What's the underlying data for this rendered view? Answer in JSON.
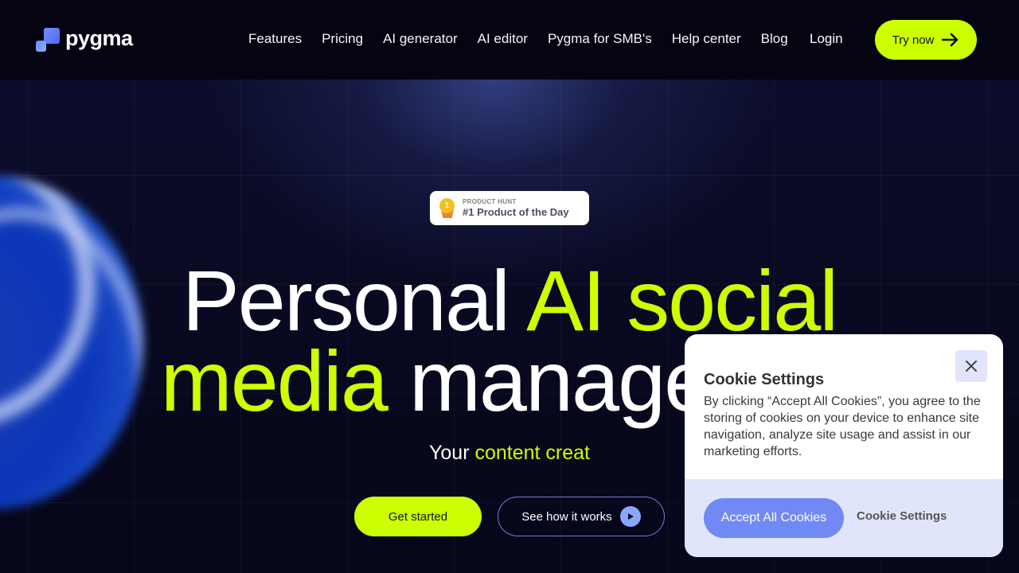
{
  "header": {
    "logo_text": "pygma",
    "nav": [
      {
        "label": "Features"
      },
      {
        "label": "Pricing"
      },
      {
        "label": "AI generator"
      },
      {
        "label": "AI editor"
      },
      {
        "label": "Pygma for SMB's"
      },
      {
        "label": "Help center"
      },
      {
        "label": "Blog"
      }
    ],
    "login_label": "Login",
    "try_label": "Try now"
  },
  "hero": {
    "badge": {
      "medal_number": "1",
      "small": "PRODUCT HUNT",
      "big": "#1 Product of the Day"
    },
    "headline": {
      "line1_white": "Personal",
      "line1_lime": "AI social",
      "line2_lime": "media",
      "line2_white": "manager"
    },
    "subtitle": {
      "white": "Your",
      "lime": "content creat"
    },
    "get_started_label": "Get started",
    "see_how_label": "See how it works"
  },
  "cookie": {
    "title": "Cookie Settings",
    "body": "By clicking “Accept All Cookies”, you agree to the storing of cookies on your device to enhance site navigation, analyze site usage and assist in our marketing efforts.",
    "accept_label": "Accept All Cookies",
    "settings_label": "Cookie Settings"
  },
  "colors": {
    "accent_lime": "#ccff00",
    "accent_blue": "#7189f5",
    "background": "#07071a"
  }
}
